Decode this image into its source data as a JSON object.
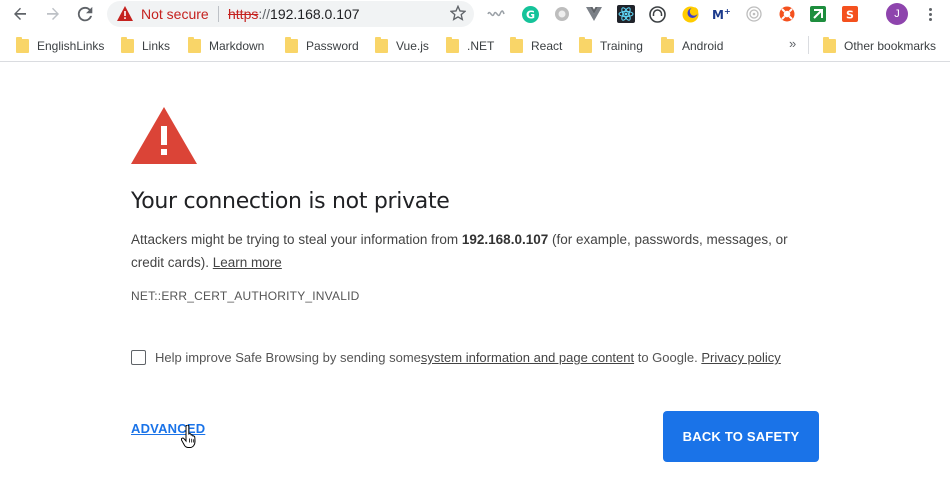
{
  "toolbar": {
    "security_label": "Not secure",
    "url_scheme": "https",
    "url_sep": "://",
    "url_host": "192.168.0.107",
    "profile_initial": "J"
  },
  "bookmarks": {
    "items": [
      {
        "label": "EnglishLinks"
      },
      {
        "label": "Links"
      },
      {
        "label": "Markdown"
      },
      {
        "label": "Password"
      },
      {
        "label": "Vue.js"
      },
      {
        "label": ".NET"
      },
      {
        "label": "React"
      },
      {
        "label": "Training"
      },
      {
        "label": "Android"
      }
    ],
    "overflow": "»",
    "other": "Other bookmarks"
  },
  "extensions": [
    "web-clipper-icon",
    "grammarly-icon",
    "circle-icon",
    "vue-devtools-icon",
    "react-devtools-icon",
    "headphones-icon",
    "moon-icon",
    "m-plus-icon",
    "target-icon",
    "lifebuoy-icon",
    "green-arrow-icon",
    "orange-s-icon"
  ],
  "colors": {
    "accent": "#1a73e8",
    "danger": "#c5221f",
    "warning_triangle": "#db4437"
  },
  "interstitial": {
    "title": "Your connection is not private",
    "desc_part1": "Attackers might be trying to steal your information from ",
    "desc_host": "192.168.0.107",
    "desc_part2": " (for example, passwords, messages, or credit cards). ",
    "learn_more": "Learn more",
    "error_code": "NET::ERR_CERT_AUTHORITY_INVALID",
    "optin_text1": "Help improve Safe Browsing by sending some ",
    "optin_link1": "system information and page content",
    "optin_text2": " to Google. ",
    "optin_link2": "Privacy policy",
    "advanced_label": "ADVANCED",
    "back_label": "BACK TO SAFETY"
  }
}
